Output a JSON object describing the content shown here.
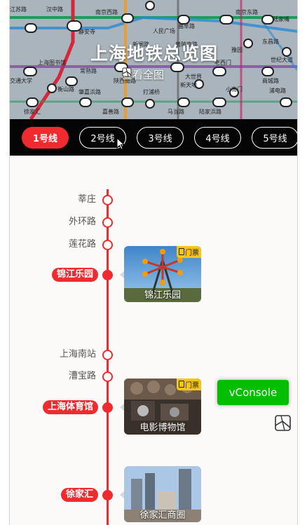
{
  "header": {
    "title": "上海地铁总览图",
    "view_all_label": "查看全图"
  },
  "tabs": [
    {
      "label": "1号线",
      "active": true
    },
    {
      "label": "2号线",
      "active": false
    },
    {
      "label": "3号线",
      "active": false
    },
    {
      "label": "4号线",
      "active": false
    },
    {
      "label": "5号线",
      "active": false
    }
  ],
  "map_labels": {
    "station_1": "南京西路",
    "station_2": "静安寺",
    "station_3": "人民广场",
    "station_4": "南京东路",
    "station_5": "陆家嘴",
    "station_6": "东昌路",
    "station_7": "上海图书馆",
    "station_8": "衡山路",
    "station_9": "常熟路",
    "station_10": "陕西南路",
    "station_11": "新天地",
    "station_12": "老西门",
    "station_13": "豫园",
    "station_14": "世纪大道",
    "station_15": "商城路",
    "station_16": "小南门",
    "station_17": "徐家汇",
    "station_18": "嘉善路",
    "station_19": "马当路",
    "station_20": "陆家浜路",
    "station_21": "浦电路",
    "station_22": "打浦桥",
    "station_23": "肇嘉浜路",
    "station_24": "交通大学",
    "station_25": "江苏路",
    "station_26": "曲阜路",
    "station_27": "汉中路",
    "station_28": "新闸路",
    "station_29": "黄陂南路",
    "station_30": "大世界"
  },
  "stations": [
    {
      "name": "莘庄",
      "highlight": false
    },
    {
      "name": "外环路",
      "highlight": false
    },
    {
      "name": "莲花路",
      "highlight": false
    },
    {
      "name": "锦江乐园",
      "highlight": true
    },
    {
      "name": "上海南站",
      "highlight": false
    },
    {
      "name": "漕宝路",
      "highlight": false
    },
    {
      "name": "上海体育馆",
      "highlight": true
    },
    {
      "name": "徐家汇",
      "highlight": true
    }
  ],
  "cards": [
    {
      "label": "锦江乐园",
      "badge": "门票"
    },
    {
      "label": "电影博物馆",
      "badge": "门票"
    },
    {
      "label": "徐家汇商圈",
      "badge": ""
    }
  ],
  "vconsole_label": "vConsole",
  "icons": {
    "view_all": "map-icon",
    "map_button": "map-icon",
    "ticket": "ticket-icon",
    "cursor": "mouse-pointer-icon"
  },
  "colors": {
    "line1": "#ee2b2f",
    "tabs_bg": "#050505",
    "vconsole": "#04be02",
    "ticket_badge": "#f5c518"
  }
}
